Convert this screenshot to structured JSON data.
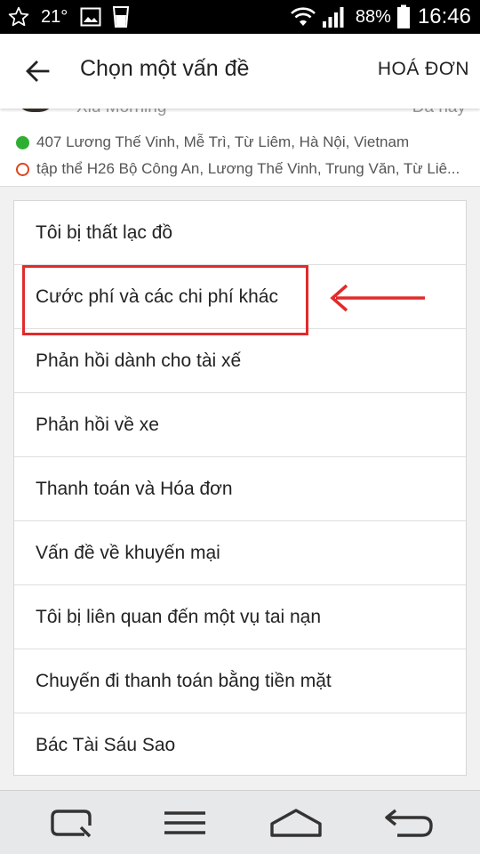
{
  "status_bar": {
    "temperature": "21°",
    "battery_percent": "88%",
    "time": "16:46",
    "icons": [
      "star-icon",
      "weather-icon",
      "image-icon",
      "cup-icon",
      "wifi-icon",
      "signal-icon",
      "battery-icon"
    ]
  },
  "app_bar": {
    "title": "Chọn một vấn đề",
    "action_label": "HOÁ ĐƠN"
  },
  "trip": {
    "service_partial": "Xiu Morning",
    "date_partial": "Đã nay",
    "pickup_address": "407 Lương Thế Vinh, Mễ Trì, Từ Liêm, Hà Nội, Vietnam",
    "dropoff_address": "tập thể H26 Bộ Công An, Lương Thế Vinh, Trung Văn, Từ Liê..."
  },
  "issues": [
    {
      "label": "Tôi bị thất lạc đồ"
    },
    {
      "label": "Cước phí và các chi phí khác"
    },
    {
      "label": "Phản hồi dành cho tài xế"
    },
    {
      "label": "Phản hồi về xe"
    },
    {
      "label": "Thanh toán và Hóa đơn"
    },
    {
      "label": "Vấn đề về khuyến mại"
    },
    {
      "label": "Tôi bị liên quan đến một vụ tai nạn"
    },
    {
      "label": "Chuyến đi thanh toán bằng tiền mặt"
    },
    {
      "label": "Bác Tài Sáu Sao"
    }
  ],
  "annotation": {
    "highlighted_item_index": 1,
    "color": "#e22a2a"
  },
  "colors": {
    "pickup_dot": "#2eaf31",
    "dropoff_ring": "#e0431b"
  },
  "nav_bar": {
    "icons": [
      "recent-apps-icon",
      "menu-icon",
      "home-icon",
      "back-nav-icon"
    ]
  }
}
